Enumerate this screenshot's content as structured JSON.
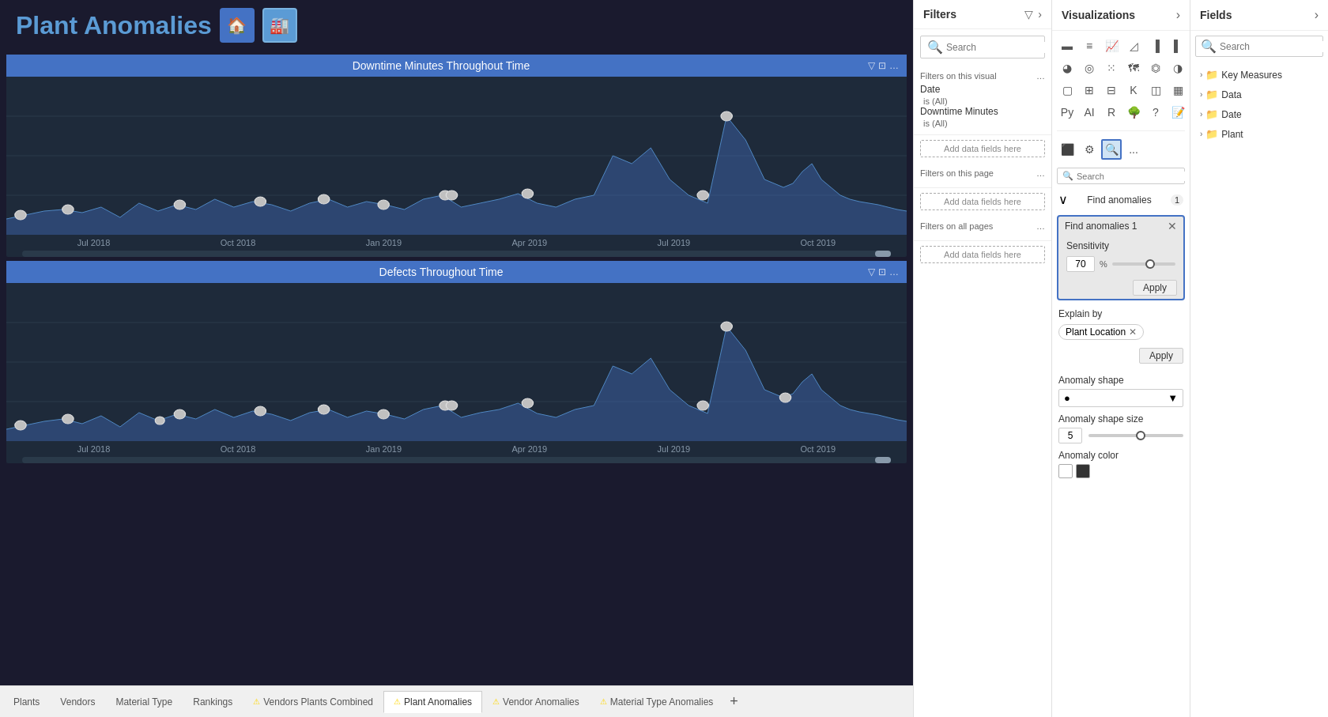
{
  "page": {
    "title": "Plant Anomalies"
  },
  "header": {
    "home_icon": "🏠",
    "building_icon": "🏭"
  },
  "charts": [
    {
      "title": "Downtime Minutes Throughout Time",
      "axis_labels": [
        "Jul 2018",
        "Oct 2018",
        "Jan 2019",
        "Apr 2019",
        "Jul 2019",
        "Oct 2019"
      ]
    },
    {
      "title": "Defects Throughout Time",
      "axis_labels": [
        "Jul 2018",
        "Oct 2018",
        "Jan 2019",
        "Apr 2019",
        "Jul 2019",
        "Oct 2019"
      ]
    }
  ],
  "filters": {
    "panel_title": "Filters",
    "search_placeholder": "Search",
    "sections": [
      {
        "title": "Filters on this visual",
        "items": [
          {
            "label": "Date",
            "sub": "is (All)"
          },
          {
            "label": "Downtime Minutes",
            "sub": "is (All)"
          }
        ]
      },
      {
        "title": "Filters on this page",
        "items": []
      },
      {
        "title": "Filters on all pages",
        "items": []
      }
    ],
    "add_data_label": "Add data fields here"
  },
  "visualizations": {
    "panel_title": "Visualizations",
    "search_placeholder": "Search",
    "find_anomalies": {
      "label": "Find anomalies",
      "count": "1",
      "popup_title": "Find anomalies 1",
      "sensitivity_label": "Sensitivity",
      "sensitivity_value": "70",
      "sensitivity_unit": "%",
      "apply_label": "Apply",
      "explain_by_label": "Explain by",
      "explain_tag": "Plant Location",
      "explain_apply_label": "Apply",
      "anomaly_shape_label": "Anomaly shape",
      "anomaly_shape_value": "●",
      "anomaly_size_label": "Anomaly shape size",
      "anomaly_size_value": "5",
      "anomaly_color_label": "Anomaly color"
    }
  },
  "fields": {
    "panel_title": "Fields",
    "search_placeholder": "Search",
    "groups": [
      {
        "label": "Key Measures",
        "expanded": false
      },
      {
        "label": "Data",
        "expanded": false
      },
      {
        "label": "Date",
        "expanded": false
      },
      {
        "label": "Plant",
        "expanded": false
      }
    ]
  },
  "tabs": [
    {
      "label": "Plants",
      "active": false,
      "anomaly": false
    },
    {
      "label": "Vendors",
      "active": false,
      "anomaly": false
    },
    {
      "label": "Material Type",
      "active": false,
      "anomaly": false
    },
    {
      "label": "Rankings",
      "active": false,
      "anomaly": false
    },
    {
      "label": "Vendors Plants Combined",
      "active": false,
      "anomaly": true
    },
    {
      "label": "Plant Anomalies",
      "active": true,
      "anomaly": true
    },
    {
      "label": "Vendor Anomalies",
      "active": false,
      "anomaly": true
    },
    {
      "label": "Material Type Anomalies",
      "active": false,
      "anomaly": true
    }
  ]
}
